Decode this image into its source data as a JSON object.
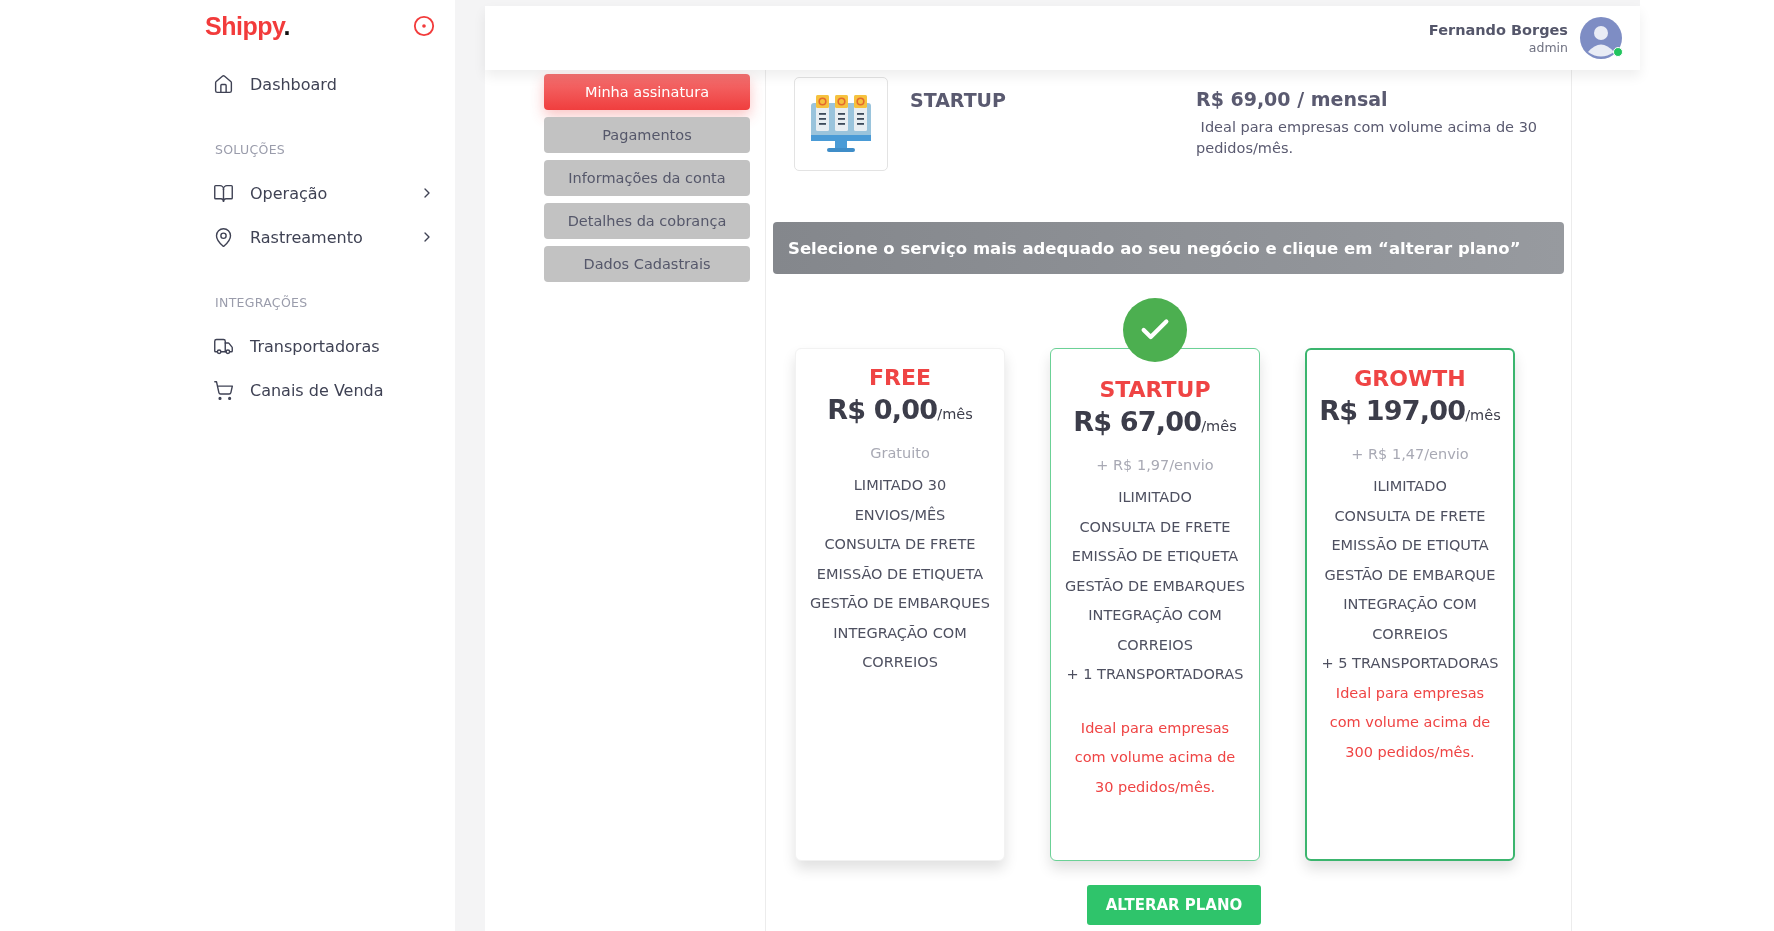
{
  "sidebar": {
    "logo": {
      "name": "Shippy",
      "mark": "."
    },
    "sections": [
      {
        "items": [
          {
            "label": "Dashboard",
            "kind": "link"
          }
        ]
      },
      {
        "title": "SOLUÇÕES",
        "items": [
          {
            "label": "Operação",
            "kind": "group",
            "expanded": false
          },
          {
            "label": "Rastreamento",
            "kind": "group",
            "expanded": false
          }
        ]
      },
      {
        "title": "INTEGRAÇÕES",
        "items": [
          {
            "label": "Transportadoras",
            "kind": "link"
          },
          {
            "label": "Canais de Venda",
            "kind": "link"
          }
        ]
      }
    ]
  },
  "header": {
    "user_name": "Fernando Borges",
    "user_role": "admin",
    "online": true
  },
  "submenu": [
    {
      "label": "Minha assinatura",
      "selected": true
    },
    {
      "label": "Pagamentos",
      "selected": false
    },
    {
      "label": "Informações da conta",
      "selected": false
    },
    {
      "label": "Detalhes da cobrança",
      "selected": false
    },
    {
      "label": "Dados Cadastrais",
      "selected": false
    }
  ],
  "current_plan": {
    "name": "STARTUP",
    "price": "R$ 69,00 / mensal",
    "description": " Ideal para empresas com volume acima de 30 pedidos/mês."
  },
  "banner": "Selecione o serviço mais adequado ao seu negócio e clique em “alterar plano”",
  "plans": [
    {
      "name": "FREE",
      "price": "R$ 0,00",
      "period": "/mês",
      "fee": "Gratuito",
      "selected": false,
      "featured": false,
      "features": [
        "LIMITADO 30 ENVIOS/MÊS",
        "CONSULTA DE FRETE",
        "EMISSÃO DE ETIQUETA",
        "GESTÃO DE EMBARQUES",
        "INTEGRAÇÃO COM CORREIOS"
      ]
    },
    {
      "name": "STARTUP",
      "price": "R$ 67,00",
      "period": "/mês",
      "fee": "+ R$ 1,97/envio",
      "selected": true,
      "featured": false,
      "features": [
        "ILIMITADO",
        "CONSULTA DE FRETE",
        "EMISSÃO DE ETIQUETA",
        "GESTÃO DE EMBARQUES",
        "INTEGRAÇÃO COM CORREIOS",
        "+ 1 TRANSPORTADORAS"
      ],
      "note": "Ideal para empresas com volume acima de 30 pedidos/mês."
    },
    {
      "name": "GROWTH",
      "price": "R$ 197,00",
      "period": "/mês",
      "fee": "+ R$ 1,47/envio",
      "selected": false,
      "featured": true,
      "features": [
        "ILIMITADO",
        "CONSULTA DE FRETE",
        "EMISSÃO DE ETIQUTA",
        "GESTÃO DE EMBARQUE",
        "INTEGRAÇÃO COM CORREIOS",
        "+ 5 TRANSPORTADORAS"
      ],
      "note": "Ideal para empresas com volume acima de 300 pedidos/mês."
    }
  ],
  "action_button": "ALTERAR PLANO"
}
